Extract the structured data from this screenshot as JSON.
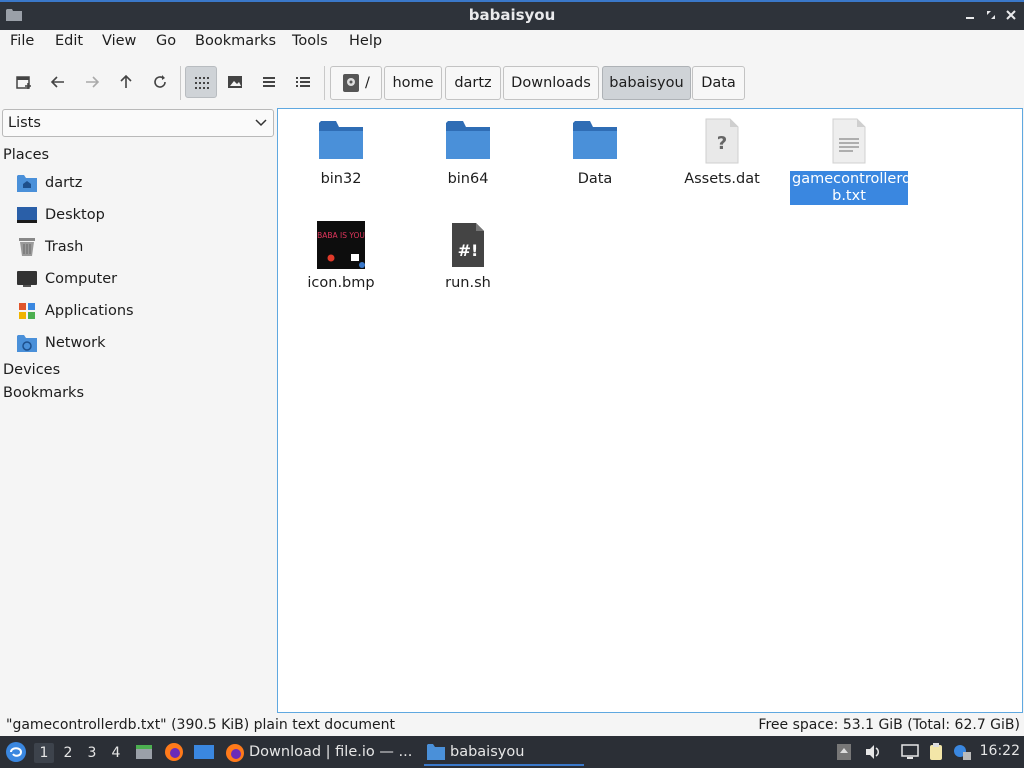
{
  "window": {
    "title": "babaisyou"
  },
  "menu": [
    "File",
    "Edit",
    "View",
    "Go",
    "Bookmarks",
    "Tools",
    "Help"
  ],
  "breadcrumbs": [
    "/",
    "home",
    "dartz",
    "Downloads",
    "babaisyou",
    "Data"
  ],
  "breadcrumb_active": "babaisyou",
  "sidebar": {
    "dropdown": "Lists",
    "places_heading": "Places",
    "places": [
      {
        "label": "dartz",
        "icon": "home-folder-icon"
      },
      {
        "label": "Desktop",
        "icon": "desktop-icon"
      },
      {
        "label": "Trash",
        "icon": "trash-icon"
      },
      {
        "label": "Computer",
        "icon": "computer-icon"
      },
      {
        "label": "Applications",
        "icon": "applications-icon"
      },
      {
        "label": "Network",
        "icon": "network-icon"
      }
    ],
    "devices_heading": "Devices",
    "bookmarks_heading": "Bookmarks"
  },
  "files": [
    {
      "name": "bin32",
      "type": "folder"
    },
    {
      "name": "bin64",
      "type": "folder"
    },
    {
      "name": "Data",
      "type": "folder"
    },
    {
      "name": "Assets.dat",
      "type": "unknown"
    },
    {
      "name": "gamecontrollerdb.txt",
      "name_line1": "gamecontrollerd",
      "name_line2": "b.txt",
      "type": "text",
      "selected": true
    },
    {
      "name": "icon.bmp",
      "type": "image",
      "image_text": "BABA IS YOU"
    },
    {
      "name": "run.sh",
      "type": "script"
    }
  ],
  "status": {
    "selection": "\"gamecontrollerdb.txt\" (390.5 KiB) plain text document",
    "free_space": "Free space: 53.1 GiB (Total: 62.7 GiB)"
  },
  "taskbar": {
    "workspaces": [
      "1",
      "2",
      "3",
      "4"
    ],
    "active_workspace": "1",
    "tasks": [
      {
        "label": "Download | file.io — ...",
        "icon": "firefox-icon"
      },
      {
        "label": "babaisyou",
        "icon": "folder-icon"
      }
    ],
    "clock": "16:22"
  },
  "colors": {
    "accent": "#3a87e0",
    "folder": "#4a90d9",
    "titlebar": "#2e333a",
    "taskbar": "#2b2f36"
  }
}
